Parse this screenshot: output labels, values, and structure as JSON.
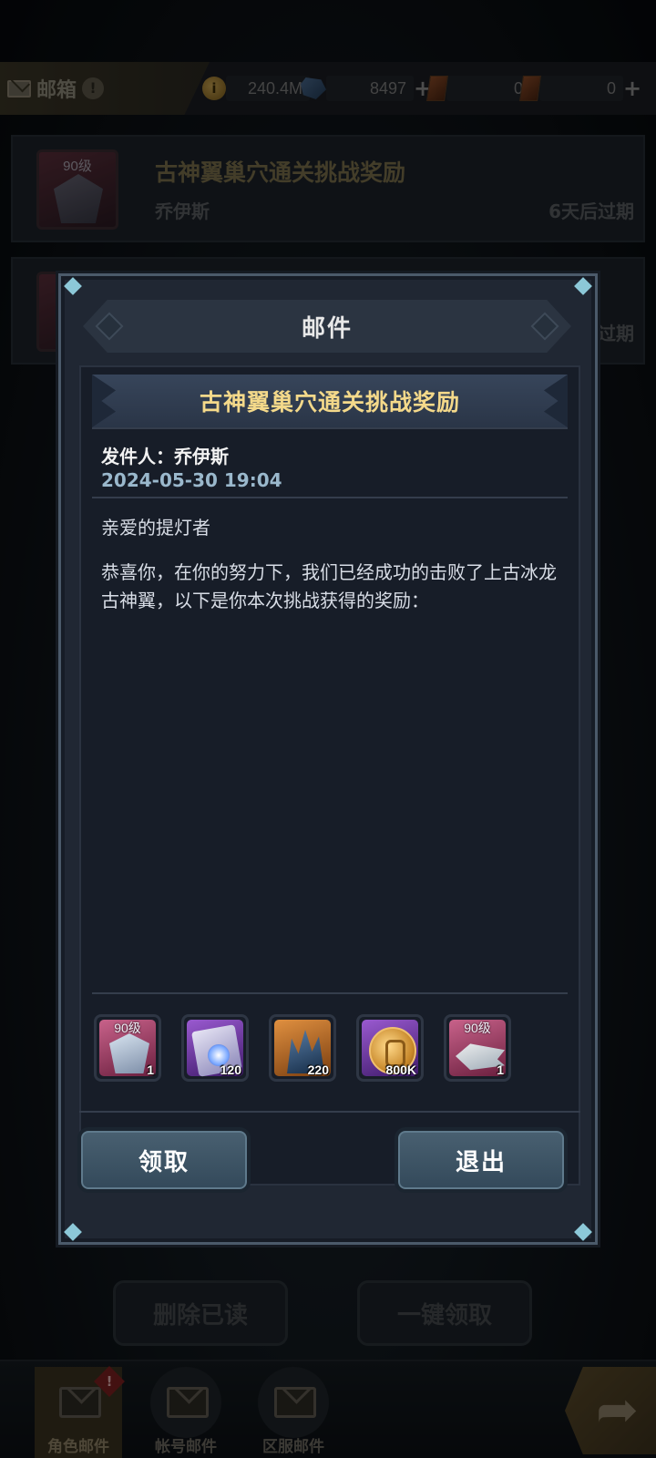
{
  "topbar": {
    "title": "邮箱",
    "warning_badge": "!",
    "currencies": [
      {
        "icon": "coin-icon",
        "value": "240.4M"
      },
      {
        "icon": "gem-icon",
        "value": "8497"
      },
      {
        "icon": "card-red-icon",
        "value": "0"
      },
      {
        "icon": "card-orange-icon",
        "value": "0"
      }
    ]
  },
  "mail_list": [
    {
      "level": "90级",
      "subject": "古神翼巢穴通关挑战奖励",
      "sender": "乔伊斯",
      "expiry": "6天后过期"
    },
    {
      "level": "",
      "subject": "",
      "sender": "",
      "expiry": "过期"
    }
  ],
  "bottom_actions": {
    "delete_read": "删除已读",
    "claim_all": "一键领取"
  },
  "bottom_nav": [
    {
      "label": "角色邮件",
      "icon": "envelope-icon",
      "badge": "!"
    },
    {
      "label": "帐号邮件",
      "icon": "envelope-person-icon"
    },
    {
      "label": "区服邮件",
      "icon": "envelope-shield-icon"
    }
  ],
  "modal": {
    "title": "邮件",
    "subject": "古神翼巢穴通关挑战奖励",
    "sender_line": "发件人：乔伊斯",
    "date": "2024-05-30 19:04",
    "greeting": "亲爱的提灯者",
    "body": "恭喜你，在你的努力下，我们已经成功的击败了上古冰龙古神翼，以下是你本次挑战获得的奖励：",
    "rewards": [
      {
        "icon": "armor-icon",
        "level": "90级",
        "quantity": "1",
        "rarity_color": "#b8406a"
      },
      {
        "icon": "scroll-orb-icon",
        "level": "",
        "quantity": "120",
        "rarity_color": "#7a3ab0"
      },
      {
        "icon": "crystal-icon",
        "level": "",
        "quantity": "220",
        "rarity_color": "#d0782a"
      },
      {
        "icon": "gold-coin-icon",
        "level": "",
        "quantity": "800K",
        "rarity_color": "#7a3ab0"
      },
      {
        "icon": "ship-icon",
        "level": "90级",
        "quantity": "1",
        "rarity_color": "#b8406a"
      }
    ],
    "claim_label": "领取",
    "exit_label": "退出"
  }
}
